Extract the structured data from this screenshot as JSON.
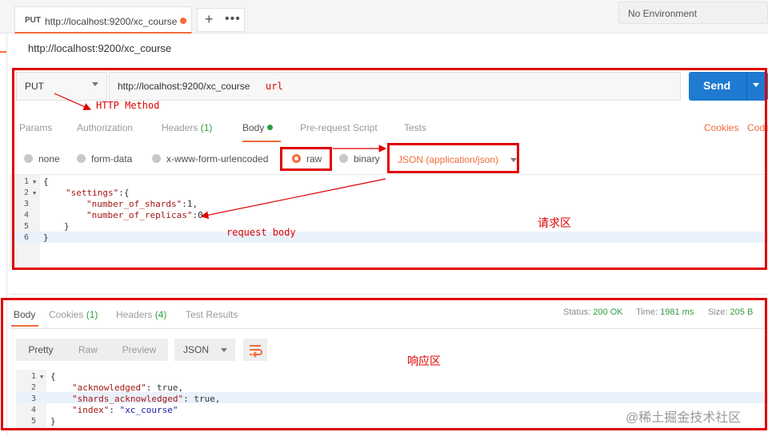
{
  "tab": {
    "method": "PUT",
    "url": "http://localhost:9200/xc_course",
    "plus": "+",
    "more": "•••"
  },
  "environment": {
    "label": "No Environment"
  },
  "request": {
    "title": "http://localhost:9200/xc_course",
    "method": "PUT",
    "url": "http://localhost:9200/xc_course",
    "send_label": "Send",
    "tabs": {
      "params": "Params",
      "authorization": "Authorization",
      "headers": "Headers",
      "headers_count": "(1)",
      "body": "Body",
      "prerequest": "Pre-request Script",
      "tests": "Tests",
      "cookies": "Cookies",
      "code": "Code"
    },
    "body_types": {
      "none": "none",
      "form_data": "form-data",
      "urlencoded": "x-www-form-urlencoded",
      "raw": "raw",
      "binary": "binary",
      "content_type": "JSON (application/json)"
    },
    "code": {
      "line_numbers": [
        "1",
        "2",
        "3",
        "4",
        "5",
        "6"
      ],
      "line1": "{",
      "line2_key": "\"settings\"",
      "line2_rest": ":{",
      "line3_key": "\"number_of_shards\"",
      "line3_rest": ":1,",
      "line4_key": "\"number_of_replicas\"",
      "line4_rest": ":0",
      "line5": "}",
      "line6": "}"
    }
  },
  "response": {
    "tabs": {
      "body": "Body",
      "cookies": "Cookies",
      "cookies_count": "(1)",
      "headers": "Headers",
      "headers_count": "(4)",
      "test_results": "Test Results"
    },
    "status_label": "Status:",
    "status_value": "200 OK",
    "time_label": "Time:",
    "time_value": "1981 ms",
    "size_label": "Size:",
    "size_value": "205 B",
    "view_modes": {
      "pretty": "Pretty",
      "raw": "Raw",
      "preview": "Preview"
    },
    "format": "JSON",
    "code": {
      "line_numbers": [
        "1",
        "2",
        "3",
        "4",
        "5"
      ],
      "line1": "{",
      "line2_key": "\"acknowledged\"",
      "line2_rest": ": true,",
      "line3_key": "\"shards_acknowledged\"",
      "line3_rest": ": true,",
      "line4_key": "\"index\"",
      "line4_sep": ": ",
      "line4_val": "\"xc_course\"",
      "line5": "}"
    }
  },
  "annotations": {
    "url": "url",
    "http_method": "HTTP Method",
    "request_body": "request body",
    "request_area": "请求区",
    "response_area": "响应区"
  },
  "watermark": "@稀土掘金技术社区",
  "colors": {
    "accent": "#f26b3a",
    "send": "#1f7ad1",
    "success": "#2f9e44",
    "annotation": "#e00000"
  }
}
